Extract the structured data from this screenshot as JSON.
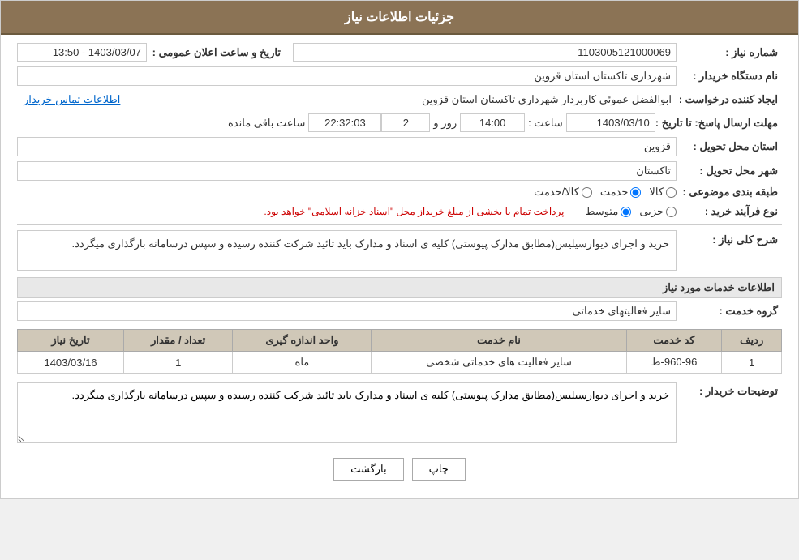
{
  "header": {
    "title": "جزئیات اطلاعات نیاز"
  },
  "fields": {
    "shomara_label": "شماره نیاز :",
    "shomara_value": "1103005121000069",
    "nam_dastgah_label": "نام دستگاه خریدار :",
    "nam_dastgah_value": "شهرداری تاکستان استان قزوین",
    "ijad_label": "ایجاد کننده درخواست :",
    "ijad_value": "ابوالفضل عموئی کاربردار شهرداری تاکستان استان قزوین",
    "ijad_link": "اطلاعات تماس خریدار",
    "mohlat_label": "مهلت ارسال پاسخ: تا تاریخ :",
    "mohlat_date": "1403/03/10",
    "mohlat_time_label": "ساعت :",
    "mohlat_time": "14:00",
    "mohlat_roz_label": "روز و",
    "mohlat_roz": "2",
    "mohlat_countdown_label": "ساعت باقی مانده",
    "mohlat_countdown": "22:32:03",
    "ostan_label": "استان محل تحویل :",
    "ostan_value": "قزوین",
    "shahr_label": "شهر محل تحویل :",
    "shahr_value": "تاکستان",
    "tabaqe_label": "طبقه بندی موضوعی :",
    "tabaqe_options": [
      {
        "id": "kala",
        "label": "کالا"
      },
      {
        "id": "khadamat",
        "label": "خدمت"
      },
      {
        "id": "kala_khadamat",
        "label": "کالا/خدمت"
      }
    ],
    "tabaqe_selected": "khadamat",
    "noeFarayand_label": "نوع فرآیند خرید :",
    "noeFarayand_options": [
      {
        "id": "jozyi",
        "label": "جزیی"
      },
      {
        "id": "motevaset",
        "label": "متوسط"
      }
    ],
    "noeFarayand_selected": "motevaset",
    "noeFarayand_note": "پرداخت تمام یا بخشی از مبلغ خریداز محل \"اسناد خزانه اسلامی\" خواهد بود.",
    "tarikh_ilan_label": "تاریخ و ساعت اعلان عمومی :",
    "tarikh_ilan_value": "1403/03/07 - 13:50"
  },
  "sharhkoli": {
    "label": "شرح کلی نیاز :",
    "text": "خرید و اجرای دیوارسیلیس(مطابق مدارک پیوستی) کلیه ی اسناد و مدارک باید تائید شرکت کننده رسیده و سپس درسامانه بارگذاری میگردد."
  },
  "section_khadamat": {
    "title": "اطلاعات خدمات مورد نیاز"
  },
  "garoh_label": "گروه خدمت :",
  "garoh_value": "سایر فعالیتهای خدماتی",
  "table": {
    "headers": [
      "ردیف",
      "کد خدمت",
      "نام خدمت",
      "واحد اندازه گیری",
      "تعداد / مقدار",
      "تاریخ نیاز"
    ],
    "rows": [
      {
        "radif": "1",
        "kod": "960-96-ط",
        "name": "سایر فعالیت های خدماتی شخصی",
        "vahed": "ماه",
        "tedad": "1",
        "tarikh": "1403/03/16"
      }
    ]
  },
  "tosihaat": {
    "label": "توضیحات خریدار :",
    "text": "خرید و اجرای دیوارسیلیس(مطابق مدارک پیوستی) کلیه ی اسناد و مدارک باید تائید شرکت کننده رسیده و سپس درسامانه بارگذاری میگردد."
  },
  "buttons": {
    "print": "چاپ",
    "back": "بازگشت"
  }
}
